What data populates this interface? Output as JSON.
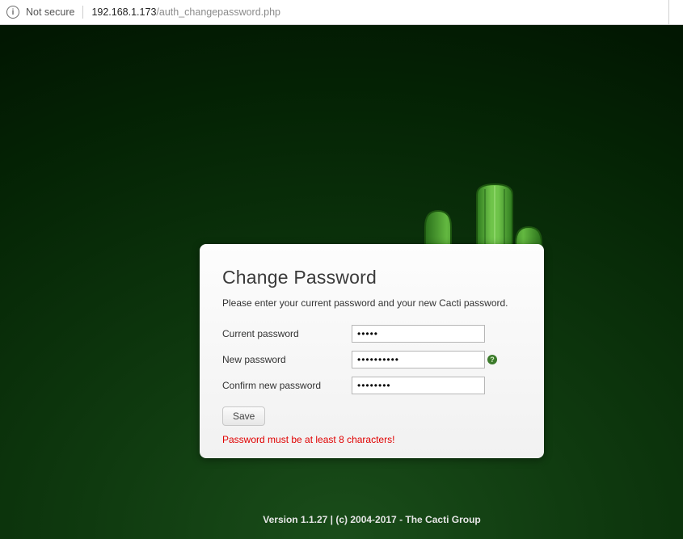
{
  "browser": {
    "security_label": "Not secure",
    "url_host": "192.168.1.173",
    "url_path": "/auth_changepassword.php"
  },
  "card": {
    "title": "Change Password",
    "instructions": "Please enter your current password and your new Cacti password.",
    "labels": {
      "current": "Current password",
      "new": "New password",
      "confirm": "Confirm new password"
    },
    "values": {
      "current": "•••••",
      "new": "••••••••••",
      "confirm": "••••••••"
    },
    "save_button": "Save",
    "error": "Password must be at least 8 characters!"
  },
  "footer": "Version 1.1.27 | (c) 2004-2017 - The Cacti Group",
  "icons": {
    "help": "?"
  }
}
